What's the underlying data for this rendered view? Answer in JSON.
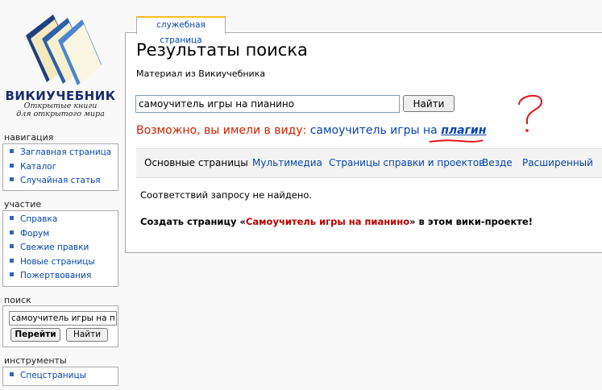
{
  "logo": {
    "brand": "ВИКИУЧЕБНИК",
    "tagline_line1": "Открытые книги",
    "tagline_line2": "для открытого мира",
    "icon": "wikibooks-logo-icon"
  },
  "sidebar": {
    "navigation": {
      "title": "навигация",
      "items": [
        "Заглавная страница",
        "Каталог",
        "Случайная статья"
      ]
    },
    "participation": {
      "title": "участие",
      "items": [
        "Справка",
        "Форум",
        "Свежие правки",
        "Новые страницы",
        "Пожертвования"
      ]
    },
    "search": {
      "title": "поиск",
      "value": "самоучитель игры на пиа",
      "go_label": "Перейти",
      "find_label": "Найти"
    },
    "tools": {
      "title": "инструменты",
      "items": [
        "Спецстраницы"
      ]
    }
  },
  "tab": {
    "label": "служебная страница"
  },
  "main": {
    "title": "Результаты поиска",
    "subtitle": "Материал из Викиучебника",
    "search_value": "самоучитель игры на пианино",
    "search_button": "Найти",
    "did_you_mean_prefix": "Возможно, вы имели в виду: ",
    "suggestion_plain": "самоучитель игры на ",
    "suggestion_emph": "плагин",
    "filters": [
      "Основные страницы",
      "Мультимедиа",
      "Страницы справки и проектов",
      "Везде",
      "Расширенный"
    ],
    "no_match": "Соответствий запросу не найдено.",
    "create_prefix": "Создать страницу «",
    "create_link": "Самоучитель игры на пианино",
    "create_suffix": "» в этом вики-проекте!"
  },
  "annotation": {
    "mark": "?",
    "color": "#e8131b"
  },
  "colors": {
    "link": "#0645ad",
    "redlink": "#ba0000",
    "didyou": "#cc2200",
    "tab_accent": "#fabd23"
  }
}
